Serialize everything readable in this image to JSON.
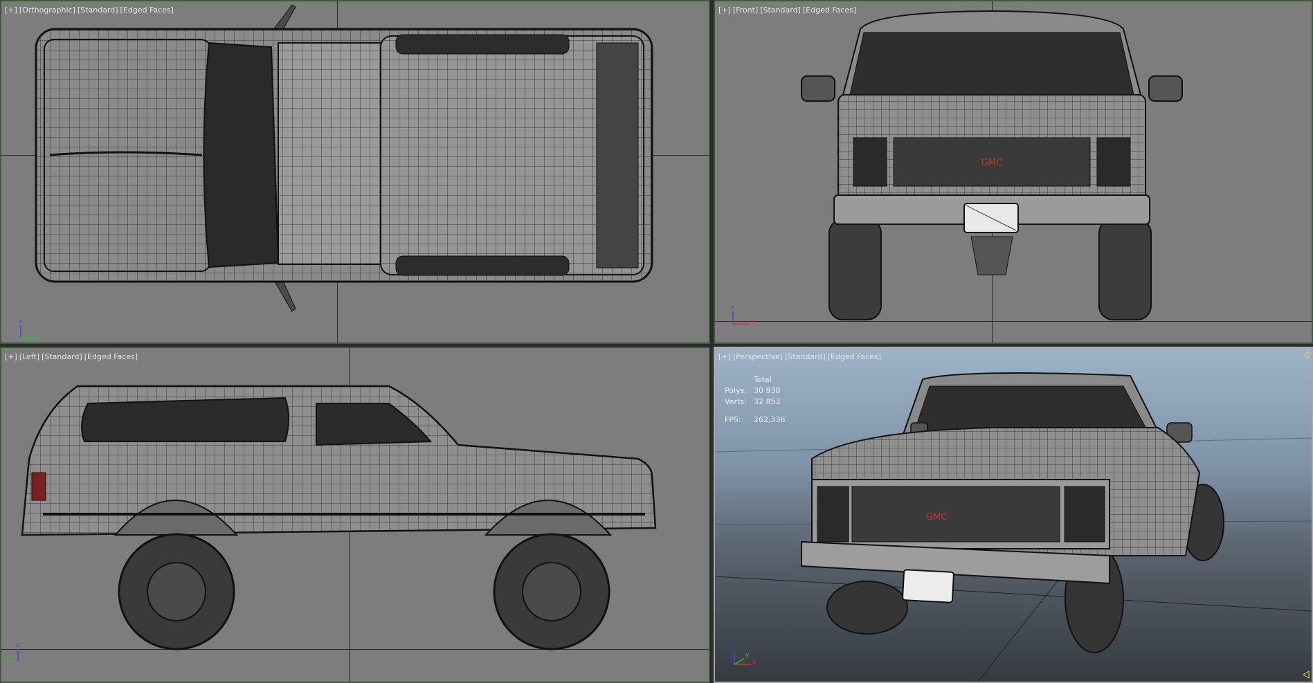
{
  "viewports": {
    "top": {
      "labels": [
        "[+]",
        "[Orthographic]",
        "[Standard]",
        "[Edged Faces]"
      ],
      "axes": {
        "a": "z",
        "b": "y"
      }
    },
    "front": {
      "labels": [
        "[+]",
        "[Front]",
        "[Standard]",
        "[Edged Faces]"
      ],
      "axes": {
        "a": "z",
        "b": "x"
      }
    },
    "left": {
      "labels": [
        "[+]",
        "[Left]",
        "[Standard]",
        "[Edged Faces]"
      ],
      "axes": {
        "a": "z",
        "b": "y"
      }
    },
    "perspective": {
      "labels": [
        "[+]",
        "[Perspective]",
        "[Standard]",
        "[Edged Faces]"
      ],
      "axes": {
        "a": "z",
        "b": "x",
        "c": "y"
      },
      "stats": {
        "header": "Total",
        "polys_label": "Polys:",
        "polys_value": "30 938",
        "verts_label": "Verts:",
        "verts_value": "32 853",
        "fps_label": "FPS:",
        "fps_value": "262,336"
      }
    }
  },
  "colors": {
    "viewport_bg": "#7d7d7d",
    "active_border": "#a9a9a9",
    "inactive_border": "#3f5a3a",
    "grille_logo": "#c0392b"
  },
  "model": {
    "grille_text": "GMC"
  }
}
